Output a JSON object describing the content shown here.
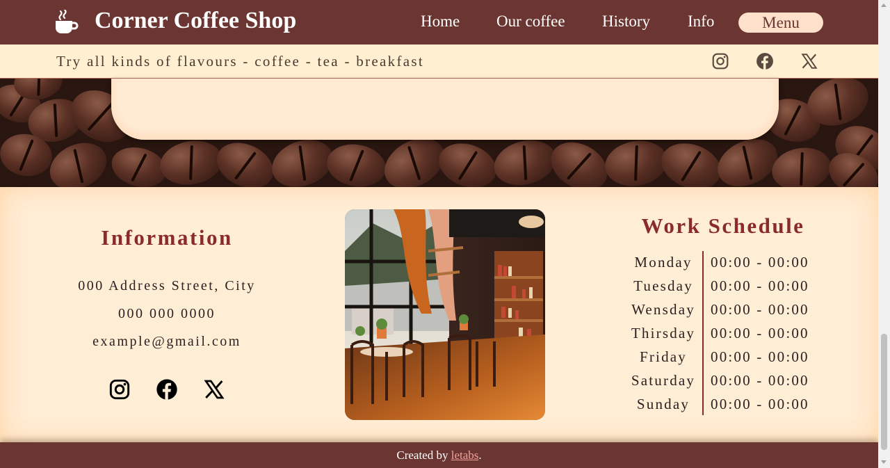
{
  "header": {
    "brand": "Corner Coffee Shop",
    "logo_icon": "coffee-cup-icon",
    "nav": [
      "Home",
      "Our coffee",
      "History",
      "Info"
    ],
    "menu_label": "Menu"
  },
  "subbar": {
    "tagline": "Try all kinds of flavours - coffee - tea - breakfast",
    "social_icons": [
      "instagram-icon",
      "facebook-icon",
      "x-icon"
    ]
  },
  "info": {
    "title": "Information",
    "address": "000 Address Street, City",
    "phone": "000 000 0000",
    "email": "example@gmail.com",
    "social_icons": [
      "instagram-icon",
      "facebook-icon",
      "x-icon"
    ]
  },
  "schedule": {
    "title": "Work Schedule",
    "rows": [
      {
        "day": "Monday",
        "hours": "00:00 - 00:00"
      },
      {
        "day": "Tuesday",
        "hours": "00:00 - 00:00"
      },
      {
        "day": "Wensday",
        "hours": "00:00 - 00:00"
      },
      {
        "day": "Thirsday",
        "hours": "00:00 - 00:00"
      },
      {
        "day": "Friday",
        "hours": "00:00 - 00:00"
      },
      {
        "day": "Saturday",
        "hours": "00:00 - 00:00"
      },
      {
        "day": "Sunday",
        "hours": "00:00 - 00:00"
      }
    ]
  },
  "footer": {
    "credit_prefix": "Created by ",
    "credit_link": "letabs",
    "credit_suffix": "."
  },
  "colors": {
    "brand_brown": "#6b3631",
    "cream": "#ffeed6",
    "accent_red": "#8b2a2a",
    "menu_button": "#ffe0cb"
  }
}
